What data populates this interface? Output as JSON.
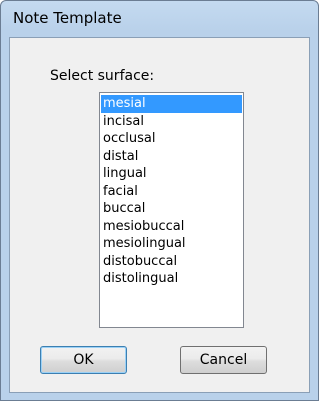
{
  "window": {
    "title": "Note Template"
  },
  "dialog": {
    "prompt": "Select surface:",
    "surfaces": [
      "mesial",
      "incisal",
      "occlusal",
      "distal",
      "lingual",
      "facial",
      "buccal",
      "mesiobuccal",
      "mesiolingual",
      "distobuccal",
      "distolingual"
    ],
    "selected_surface": "mesial",
    "ok_label": "OK",
    "cancel_label": "Cancel"
  },
  "colors": {
    "selection": "#3399ff",
    "frame": "#b9d1ea",
    "dialog_bg": "#f0f0f0"
  }
}
